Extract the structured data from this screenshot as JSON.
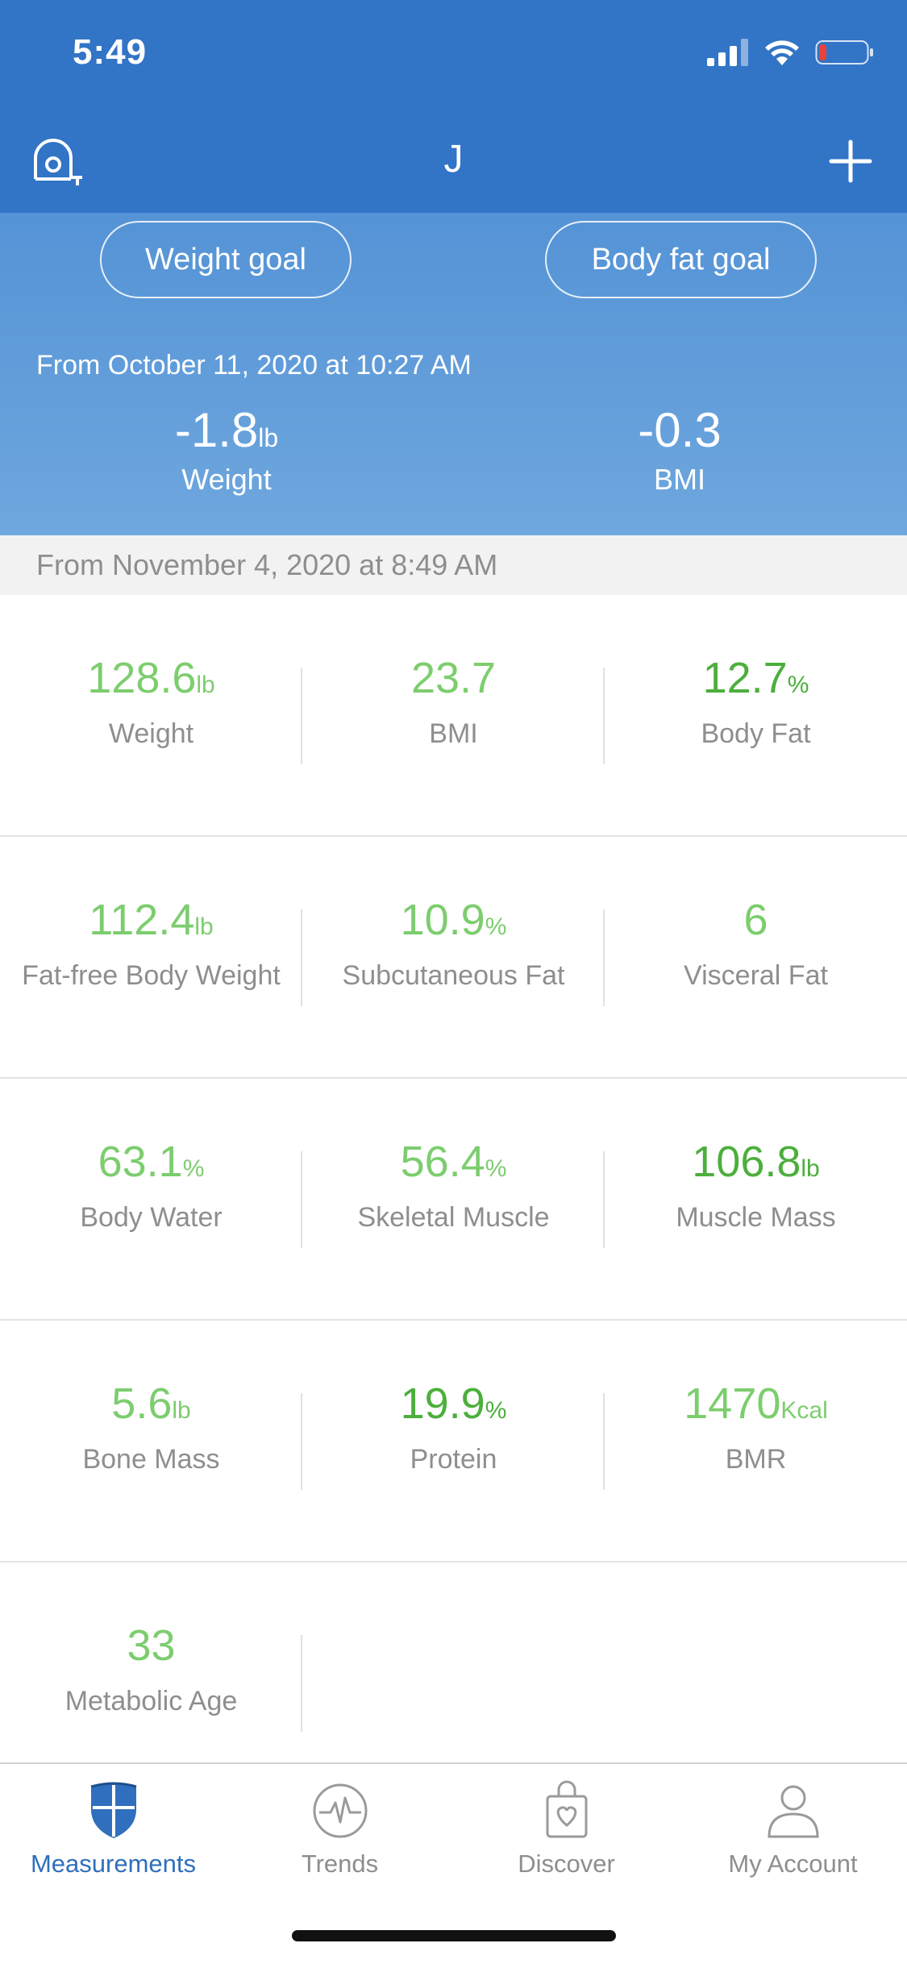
{
  "status": {
    "time": "5:49"
  },
  "header": {
    "user": "J"
  },
  "goals": {
    "weight_goal": "Weight goal",
    "body_fat_goal": "Body fat goal"
  },
  "change": {
    "from": "From October 11, 2020 at 10:27 AM",
    "weight_value": "-1.8",
    "weight_unit": "lb",
    "weight_label": "Weight",
    "bmi_value": "-0.3",
    "bmi_label": "BMI"
  },
  "measurement": {
    "from": "From November 4, 2020 at 8:49 AM"
  },
  "metrics": [
    [
      {
        "value": "128.6",
        "unit": "lb",
        "label": "Weight",
        "color": "#7ccd6e"
      },
      {
        "value": "23.7",
        "unit": "",
        "label": "BMI",
        "color": "#7ccd6e"
      },
      {
        "value": "12.7",
        "unit": "%",
        "label": "Body Fat",
        "color": "#4caf3c"
      }
    ],
    [
      {
        "value": "112.4",
        "unit": "lb",
        "label": "Fat-free Body Weight",
        "color": "#7ccd6e"
      },
      {
        "value": "10.9",
        "unit": "%",
        "label": "Subcutaneous Fat",
        "color": "#7ccd6e"
      },
      {
        "value": "6",
        "unit": "",
        "label": "Visceral Fat",
        "color": "#7ccd6e"
      }
    ],
    [
      {
        "value": "63.1",
        "unit": "%",
        "label": "Body Water",
        "color": "#7ccd6e"
      },
      {
        "value": "56.4",
        "unit": "%",
        "label": "Skeletal Muscle",
        "color": "#7ccd6e"
      },
      {
        "value": "106.8",
        "unit": "lb",
        "label": "Muscle Mass",
        "color": "#4caf3c"
      }
    ],
    [
      {
        "value": "5.6",
        "unit": "lb",
        "label": "Bone Mass",
        "color": "#7ccd6e"
      },
      {
        "value": "19.9",
        "unit": "%",
        "label": "Protein",
        "color": "#4caf3c"
      },
      {
        "value": "1470",
        "unit": "Kcal",
        "label": "BMR",
        "color": "#7ccd6e"
      }
    ],
    [
      {
        "value": "33",
        "unit": "",
        "label": "Metabolic Age",
        "color": "#7ccd6e"
      }
    ]
  ],
  "tabs": [
    {
      "label": "Measurements",
      "icon": "shield-icon",
      "active": true
    },
    {
      "label": "Trends",
      "icon": "pulse-icon",
      "active": false
    },
    {
      "label": "Discover",
      "icon": "bag-icon",
      "active": false
    },
    {
      "label": "My Account",
      "icon": "person-icon",
      "active": false
    }
  ],
  "colors": {
    "header": "#3274c6",
    "accent": "#2f6fbd",
    "green": "#7ccd6e",
    "dark_green": "#4caf3c"
  }
}
